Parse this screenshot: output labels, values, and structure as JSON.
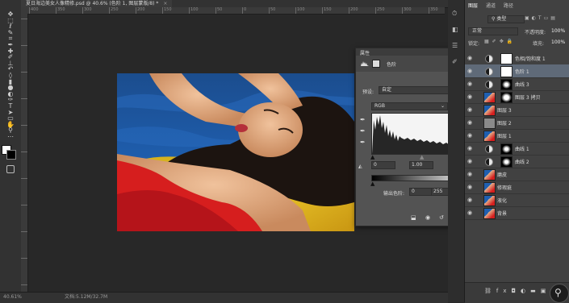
{
  "document": {
    "tab_title": "夏日海边美女人像精修.psd @ 40.6% (色阶 1, 图层蒙版/8) *",
    "zoom_status": "40.61%",
    "doc_status": "文档:5.12M/32.7M",
    "ruler_marks": [
      "400",
      "350",
      "300",
      "250",
      "200",
      "150",
      "100",
      "50",
      "0",
      "50",
      "100",
      "150",
      "200",
      "250",
      "300",
      "350"
    ]
  },
  "tools": [
    {
      "name": "move-tool",
      "glyph": "✥"
    },
    {
      "name": "marquee-tool",
      "glyph": "⬚"
    },
    {
      "name": "lasso-tool",
      "glyph": "ℓ"
    },
    {
      "name": "quick-select-tool",
      "glyph": "✎"
    },
    {
      "name": "crop-tool",
      "glyph": "⌗"
    },
    {
      "name": "eyedropper-tool",
      "glyph": "✒"
    },
    {
      "name": "heal-tool",
      "glyph": "✚"
    },
    {
      "name": "brush-tool",
      "glyph": "✐"
    },
    {
      "name": "stamp-tool",
      "glyph": "⊥"
    },
    {
      "name": "history-brush-tool",
      "glyph": "↶"
    },
    {
      "name": "eraser-tool",
      "glyph": "◊"
    },
    {
      "name": "gradient-tool",
      "glyph": "▮"
    },
    {
      "name": "blur-tool",
      "glyph": "●"
    },
    {
      "name": "dodge-tool",
      "glyph": "◐"
    },
    {
      "name": "pen-tool",
      "glyph": "✑"
    },
    {
      "name": "type-tool",
      "glyph": "T"
    },
    {
      "name": "path-select-tool",
      "glyph": "➤"
    },
    {
      "name": "shape-tool",
      "glyph": "▭"
    },
    {
      "name": "hand-tool",
      "glyph": "✋"
    },
    {
      "name": "zoom-tool",
      "glyph": "⚲"
    },
    {
      "name": "more-tools",
      "glyph": "⋯"
    }
  ],
  "properties": {
    "panel_title": "属性",
    "adjustment_name": "色阶",
    "preset_label": "预设:",
    "preset_value": "自定",
    "channel_value": "RGB",
    "auto_label": "自动",
    "input_black": "0",
    "input_gamma": "1.00",
    "input_white": "255",
    "output_label": "输出色阶:",
    "output_black": "0",
    "output_white": "255"
  },
  "layers_panel": {
    "tabs": [
      "图层",
      "通道",
      "路径"
    ],
    "filter_kind": "类型",
    "blend_mode": "正常",
    "opacity_label": "不透明度:",
    "opacity_value": "100%",
    "lock_label": "锁定:",
    "fill_label": "填充:",
    "fill_value": "100%",
    "layers": [
      {
        "name": "色相/饱和度 1",
        "type": "adjustment",
        "selected": false
      },
      {
        "name": "色阶 1",
        "type": "adjustment",
        "selected": true
      },
      {
        "name": "曲线 3",
        "type": "adjustment",
        "selected": false
      },
      {
        "name": "图层 3 拷贝",
        "type": "photo",
        "selected": false
      },
      {
        "name": "图层 3",
        "type": "photo",
        "selected": false
      },
      {
        "name": "图层 2",
        "type": "gray",
        "selected": false
      },
      {
        "name": "图层 1",
        "type": "photo",
        "selected": false
      },
      {
        "name": "曲线 1",
        "type": "adjustment",
        "selected": false
      },
      {
        "name": "曲线 2",
        "type": "adjustment",
        "selected": false
      },
      {
        "name": "磨皮",
        "type": "photo",
        "selected": false
      },
      {
        "name": "修瑕疵",
        "type": "photo",
        "selected": false
      },
      {
        "name": "液化",
        "type": "photo",
        "selected": false
      },
      {
        "name": "背景",
        "type": "photo",
        "selected": false
      }
    ]
  },
  "colors": {
    "accent_selected": "#5f6a78",
    "panel_bg": "#535353",
    "app_bg": "#282828"
  }
}
